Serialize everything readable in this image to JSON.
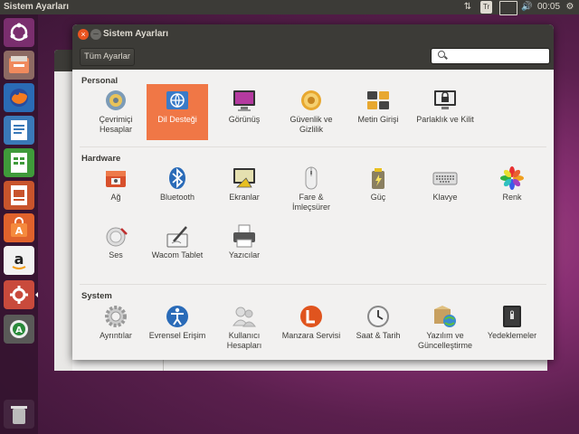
{
  "panel": {
    "app_title": "Sistem Ayarları",
    "keyboard_layout": "Tr",
    "time": "00:05"
  },
  "launcher": {
    "items": [
      "dash-home-icon",
      "files-icon",
      "firefox-icon",
      "writer-icon",
      "calc-icon",
      "impress-icon",
      "software-center-icon",
      "amazon-icon",
      "system-settings-icon",
      "software-updater-icon",
      "trash-icon"
    ]
  },
  "window": {
    "title": "Sistem Ayarları",
    "all_settings_button": "Tüm Ayarlar",
    "search_placeholder": ""
  },
  "sections": [
    {
      "title": "Personal",
      "items": [
        {
          "label": "Çevrimiçi Hesaplar",
          "icon": "online-accounts-icon"
        },
        {
          "label": "Dil Desteği",
          "icon": "language-support-icon",
          "selected": true
        },
        {
          "label": "Görünüş",
          "icon": "appearance-icon"
        },
        {
          "label": "Güvenlik ve Gizlilik",
          "icon": "security-privacy-icon"
        },
        {
          "label": "Metin Girişi",
          "icon": "text-entry-icon"
        },
        {
          "label": "Parlaklık ve Kilit",
          "icon": "brightness-lock-icon"
        }
      ]
    },
    {
      "title": "Hardware",
      "items": [
        {
          "label": "Ağ",
          "icon": "network-icon"
        },
        {
          "label": "Bluetooth",
          "icon": "bluetooth-icon"
        },
        {
          "label": "Ekranlar",
          "icon": "displays-icon"
        },
        {
          "label": "Fare & İmleçsürer",
          "icon": "mouse-touchpad-icon"
        },
        {
          "label": "Güç",
          "icon": "power-icon"
        },
        {
          "label": "Klavye",
          "icon": "keyboard-icon"
        },
        {
          "label": "Renk",
          "icon": "color-icon"
        },
        {
          "label": "Ses",
          "icon": "sound-icon"
        },
        {
          "label": "Wacom Tablet",
          "icon": "wacom-tablet-icon"
        },
        {
          "label": "Yazıcılar",
          "icon": "printers-icon"
        }
      ]
    },
    {
      "title": "System",
      "items": [
        {
          "label": "Ayrıntılar",
          "icon": "details-icon"
        },
        {
          "label": "Evrensel Erişim",
          "icon": "universal-access-icon"
        },
        {
          "label": "Kullanıcı Hesapları",
          "icon": "user-accounts-icon"
        },
        {
          "label": "Manzara Servisi",
          "icon": "landscape-service-icon"
        },
        {
          "label": "Saat & Tarih",
          "icon": "time-date-icon"
        },
        {
          "label": "Yazılım ve Güncelleştirme",
          "icon": "software-updates-icon"
        },
        {
          "label": "Yedeklemeler",
          "icon": "backups-icon"
        }
      ]
    }
  ]
}
